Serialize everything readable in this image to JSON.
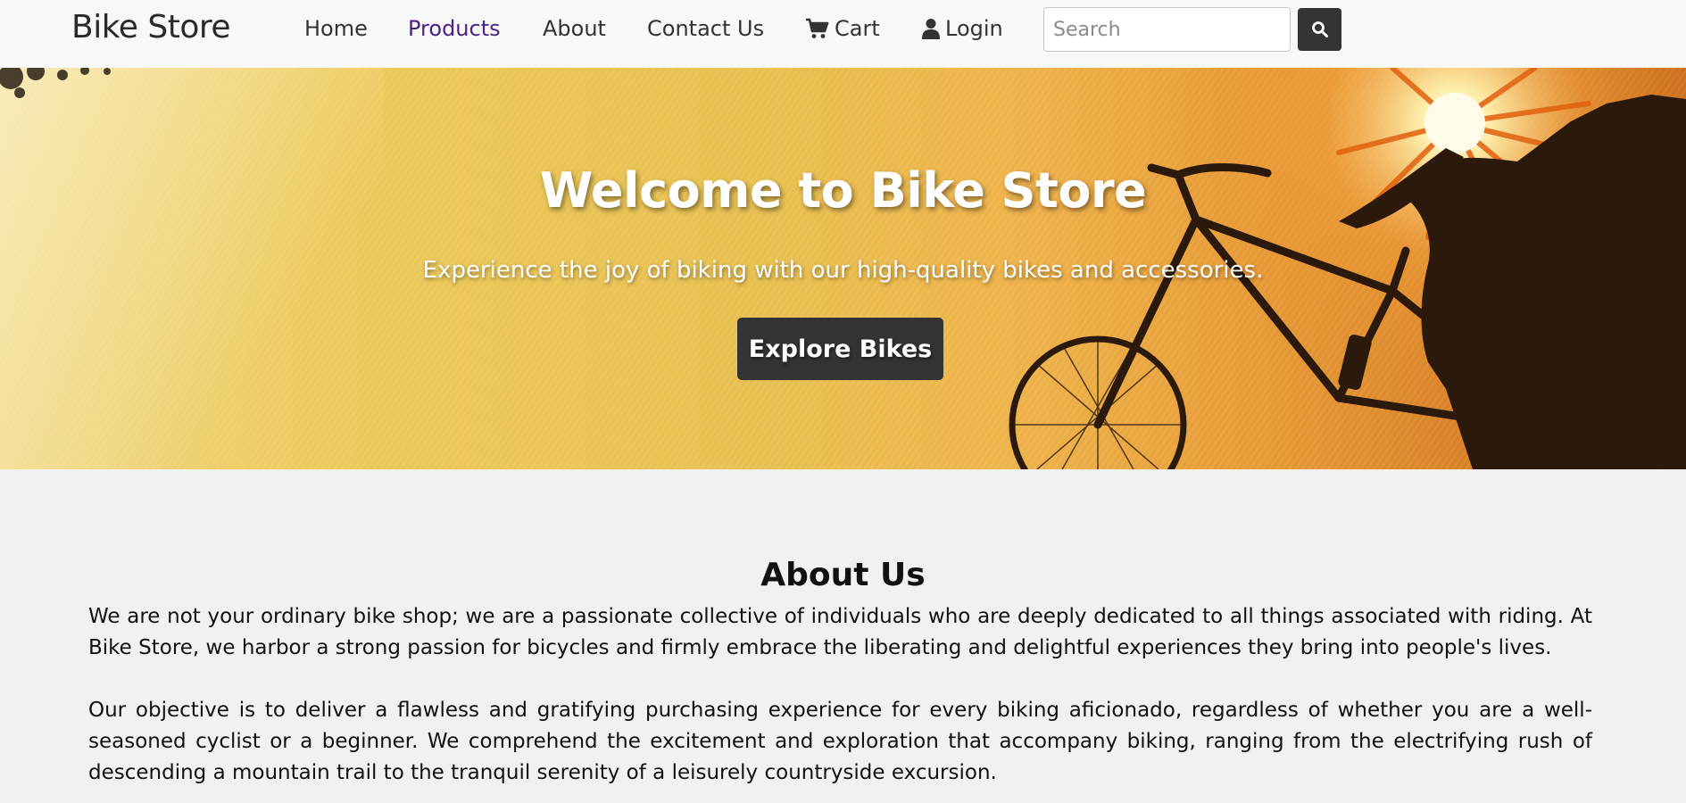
{
  "nav": {
    "brand": "Bike Store",
    "links": [
      {
        "label": "Home"
      },
      {
        "label": "Products"
      },
      {
        "label": "About"
      },
      {
        "label": "Contact Us"
      },
      {
        "label": "Cart",
        "icon": "cart-icon"
      },
      {
        "label": "Login",
        "icon": "user-icon"
      }
    ],
    "active_link": "Products",
    "search_placeholder": "Search",
    "search_icon": "search-icon"
  },
  "hero": {
    "title": "Welcome to Bike Store",
    "subtitle": "Experience the joy of biking with our high-quality bikes and accessories.",
    "button_label": "Explore Bikes"
  },
  "about": {
    "title": "About Us",
    "paragraph_1": "We are not your ordinary bike shop; we are a passionate collective of individuals who are deeply dedicated to all things associated with riding. At Bike Store, we harbor a strong passion for bicycles and firmly embrace the liberating and delightful experiences they bring into people's lives.",
    "paragraph_2": "Our objective is to deliver a flawless and gratifying purchasing experience for every biking aficionado, regardless of whether you are a well-seasoned cyclist or a beginner. We comprehend the excitement and exploration that accompany biking, ranging from the electrifying rush of descending a mountain trail to the tranquil serenity of a leisurely countryside excursion."
  },
  "colors": {
    "active_link": "#4b1f86",
    "dark_button": "#333333",
    "navbar_bg": "#f8f8f8",
    "page_bg": "#f1f1f1"
  }
}
